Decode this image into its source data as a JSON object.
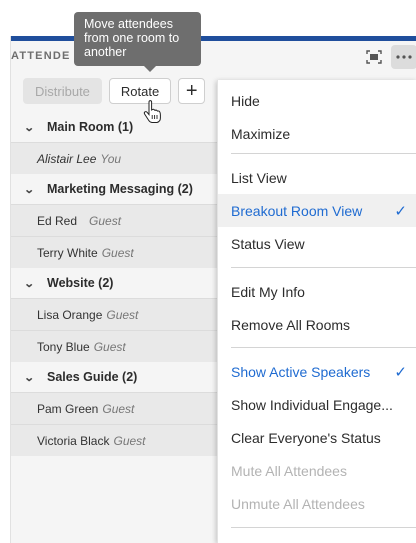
{
  "panel": {
    "title": "ATTENDE"
  },
  "header_icons": [
    "fullscreen-icon",
    "more-icon"
  ],
  "buttons": {
    "distribute": "Distribute",
    "rotate": "Rotate",
    "add": "+"
  },
  "tooltip": "Move attendees from one room to another",
  "rooms": [
    {
      "name": "Main Room (1)",
      "attendees": [
        {
          "name": "Alistair Lee",
          "tag": "You"
        }
      ]
    },
    {
      "name": "Marketing Messaging (2)",
      "attendees": [
        {
          "name": "Ed Red",
          "tag": "Guest"
        },
        {
          "name": "Terry White",
          "tag": "Guest"
        }
      ]
    },
    {
      "name": "Website (2)",
      "attendees": [
        {
          "name": "Lisa Orange",
          "tag": "Guest"
        },
        {
          "name": "Tony Blue",
          "tag": "Guest"
        }
      ]
    },
    {
      "name": "Sales Guide (2)",
      "attendees": [
        {
          "name": "Pam Green",
          "tag": "Guest"
        },
        {
          "name": "Victoria Black",
          "tag": "Guest"
        }
      ]
    }
  ],
  "menu": {
    "items": [
      {
        "label": "Hide",
        "state": "normal"
      },
      {
        "label": "Maximize",
        "state": "normal"
      },
      {
        "label": "List View",
        "state": "normal"
      },
      {
        "label": "Breakout Room View",
        "state": "selected",
        "checked": true
      },
      {
        "label": "Status View",
        "state": "normal"
      },
      {
        "label": "Edit My Info",
        "state": "normal"
      },
      {
        "label": "Remove All Rooms",
        "state": "normal"
      },
      {
        "label": "Show Active Speakers",
        "state": "blue",
        "checked": true
      },
      {
        "label": "Show Individual Engage...",
        "state": "normal"
      },
      {
        "label": "Clear Everyone's Status",
        "state": "normal"
      },
      {
        "label": "Mute All Attendees",
        "state": "disabled"
      },
      {
        "label": "Unmute All Attendees",
        "state": "disabled"
      }
    ],
    "checkmark": "✓"
  },
  "colors": {
    "accent": "#1f6bd1",
    "panel_bar": "#1f4e9c",
    "tooltip_bg": "#6e6e6e"
  }
}
